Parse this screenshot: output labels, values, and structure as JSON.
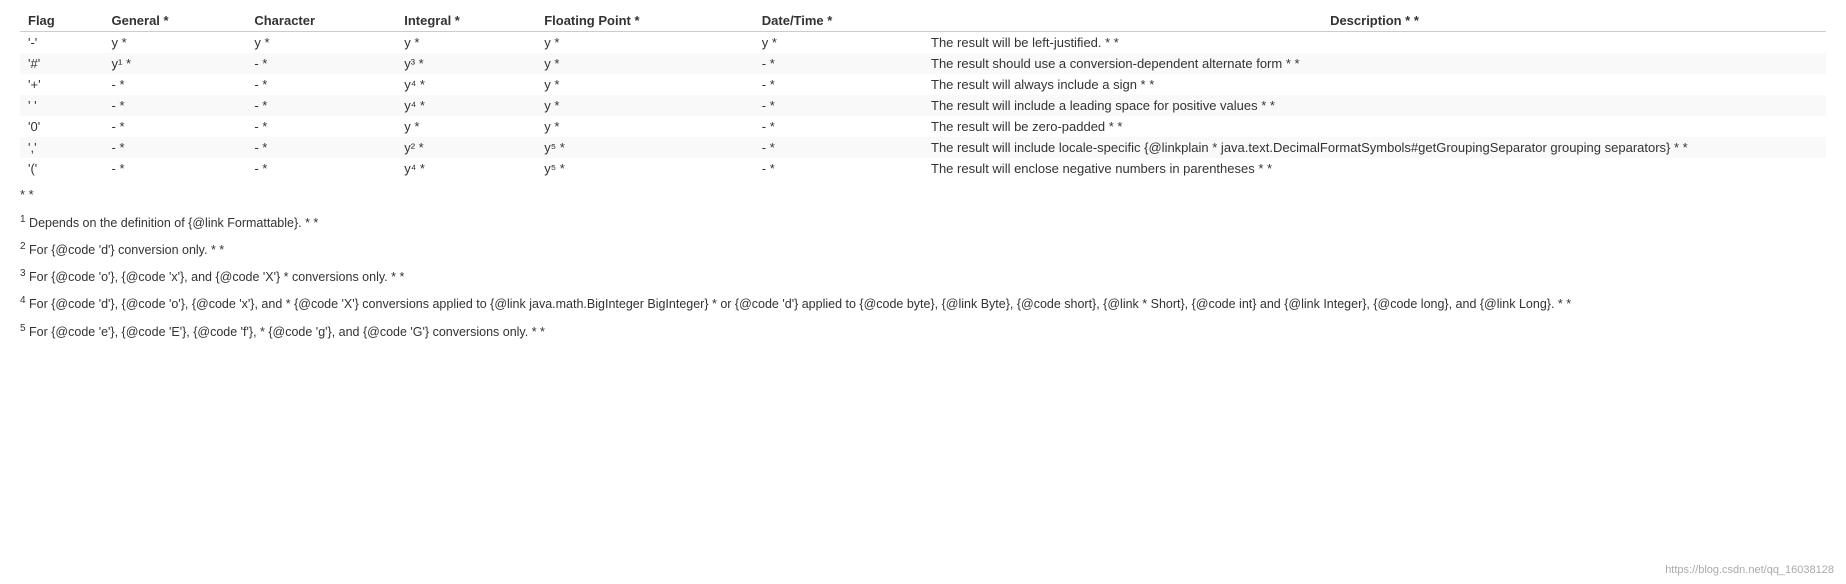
{
  "table": {
    "headers": [
      "Flag",
      "General *",
      "Character",
      "Integral *",
      "Floating Point *",
      "Date/Time *",
      "Description * *"
    ],
    "rows": [
      {
        "flag": "'-'",
        "general": "y *",
        "character": "y *",
        "integral": "y *",
        "floating": "y *",
        "datetime": "y *",
        "description": "The result will be left-justified. * *"
      },
      {
        "flag": "'#'",
        "general": "y¹ *",
        "character": "- *",
        "integral": "y³ *",
        "floating": "y *",
        "datetime": "- *",
        "description": "The result should use a conversion-dependent alternate form * *"
      },
      {
        "flag": "'+'",
        "general": "- *",
        "character": "- *",
        "integral": "y⁴ *",
        "floating": "y *",
        "datetime": "- *",
        "description": "The result will always include a sign * *"
      },
      {
        "flag": "' '",
        "general": "- *",
        "character": "- *",
        "integral": "y⁴ *",
        "floating": "y *",
        "datetime": "- *",
        "description": "The result will include a leading space for positive values * *"
      },
      {
        "flag": "'0'",
        "general": "- *",
        "character": "- *",
        "integral": "y *",
        "floating": "y *",
        "datetime": "- *",
        "description": "The result will be zero-padded * *"
      },
      {
        "flag": "','",
        "general": "- *",
        "character": "- *",
        "integral": "y² *",
        "floating": "y⁵ *",
        "datetime": "- *",
        "description": "The result will include locale-specific {@linkplain * java.text.DecimalFormatSymbols#getGroupingSeparator grouping separators} * *"
      },
      {
        "flag": "'('",
        "general": "- *",
        "character": "- *",
        "integral": "y⁴ *",
        "floating": "y⁵ *",
        "datetime": "- *",
        "description": "The result will enclose negative numbers in parentheses * *"
      }
    ],
    "trailing": "* *"
  },
  "footnotes": [
    {
      "number": "1",
      "text": "Depends on the definition of {@link Formattable}. * *"
    },
    {
      "number": "2",
      "text": "For {@code 'd'} conversion only. * *"
    },
    {
      "number": "3",
      "text": "For {@code 'o'}, {@code 'x'}, and {@code 'X'} * conversions only. * *"
    },
    {
      "number": "4",
      "text": "For {@code 'd'}, {@code 'o'}, {@code 'x'}, and * {@code 'X'} conversions applied to {@link java.math.BigInteger BigInteger} * or {@code 'd'} applied to {@code byte}, {@link Byte}, {@code short}, {@link * Short}, {@code int} and {@link Integer}, {@code long}, and {@link Long}. * *"
    },
    {
      "number": "5",
      "text": "For {@code 'e'}, {@code 'E'}, {@code 'f'}, * {@code 'g'}, and {@code 'G'} conversions only. * *"
    }
  ],
  "watermark": "https://blog.csdn.net/qq_16038128"
}
